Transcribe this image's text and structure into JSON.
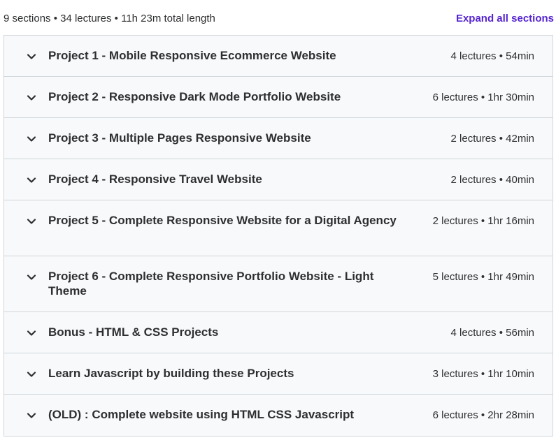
{
  "summary": {
    "text": "9 sections • 34 lectures • 11h 23m total length",
    "expand_all_label": "Expand all sections"
  },
  "sections": [
    {
      "title": "Project 1 - Mobile Responsive Ecommerce Website",
      "meta": "4 lectures • 54min"
    },
    {
      "title": "Project 2 - Responsive Dark Mode Portfolio Website",
      "meta": "6 lectures • 1hr 30min"
    },
    {
      "title": "Project 3 - Multiple Pages Responsive Website",
      "meta": "2 lectures • 42min"
    },
    {
      "title": "Project 4 - Responsive Travel Website",
      "meta": "2 lectures • 40min"
    },
    {
      "title": "Project 5 - Complete Responsive Website for a Digital Agency",
      "meta": "2 lectures • 1hr 16min"
    },
    {
      "title": "Project 6 - Complete Responsive Portfolio Website - Light Theme",
      "meta": "5 lectures • 1hr 49min"
    },
    {
      "title": "Bonus - HTML & CSS Projects",
      "meta": "4 lectures • 56min"
    },
    {
      "title": "Learn Javascript by building these Projects",
      "meta": "3 lectures • 1hr 10min"
    },
    {
      "title": "(OLD) : Complete website using HTML CSS Javascript",
      "meta": "6 lectures • 2hr 28min"
    }
  ],
  "icons": {
    "section_toggle": "chevron-down-icon"
  },
  "colors": {
    "accent": "#5624d0",
    "text": "#2d2f31",
    "section_bg": "#f7f9fa",
    "border": "#d1d7dc"
  }
}
